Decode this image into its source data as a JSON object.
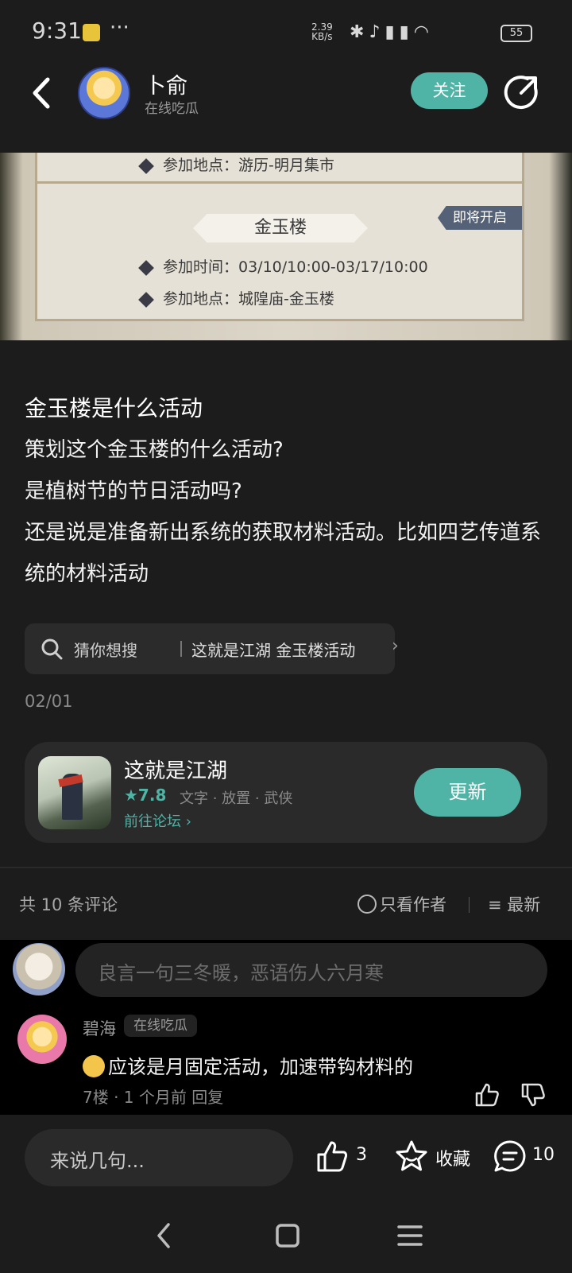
{
  "status_bar": {
    "time": "9:31",
    "more": "···",
    "speed_value": "2.39",
    "speed_unit": "KB/s",
    "battery": "55",
    "icons": [
      "bluetooth-icon",
      "mute-icon",
      "hd-signal-icon",
      "signal-icon",
      "wifi-icon",
      "battery-icon"
    ]
  },
  "header": {
    "author_name": "卜俞",
    "author_subtitle": "在线吃瓜",
    "follow_label": "关注"
  },
  "post_image": {
    "row_top": "参加地点：游历-明月集市",
    "card_title": "金玉楼",
    "ribbon": "即将开启",
    "time_row": "参加时间：03/10/10:00-03/17/10:00",
    "place_row": "参加地点：城隍庙-金玉楼"
  },
  "post": {
    "title": "金玉楼是什么活动",
    "lines": [
      "策划这个金玉楼的什么活动?",
      "是植树节的节日活动吗?",
      "还是说是准备新出系统的获取材料活动。比如四艺传道系统的材料活动"
    ],
    "suggest_label": "猜你想搜",
    "suggest_query": "这就是江湖 金玉楼活动",
    "date": "02/01"
  },
  "game": {
    "name": "这就是江湖",
    "score": "★7.8",
    "tags": "文字 · 放置 · 武侠",
    "forum_link": "前往论坛 ›",
    "update_label": "更新"
  },
  "comments_header": {
    "count": "共 10 条评论",
    "only_author": "只看作者",
    "sort": "最新"
  },
  "comment_input_placeholder": "良言一句三冬暖，恶语伤人六月寒",
  "comment": {
    "name": "碧海",
    "badge": "在线吃瓜",
    "text": "应该是月固定活动，加速带钩材料的",
    "meta": "7楼 · 1 个月前  回复"
  },
  "bottom_bar": {
    "input_placeholder": "来说几句...",
    "like_count": "3",
    "favorite_label": "收藏",
    "comment_count": "10"
  },
  "colors": {
    "accent": "#4fb3a5",
    "background": "#1c1c1c"
  }
}
